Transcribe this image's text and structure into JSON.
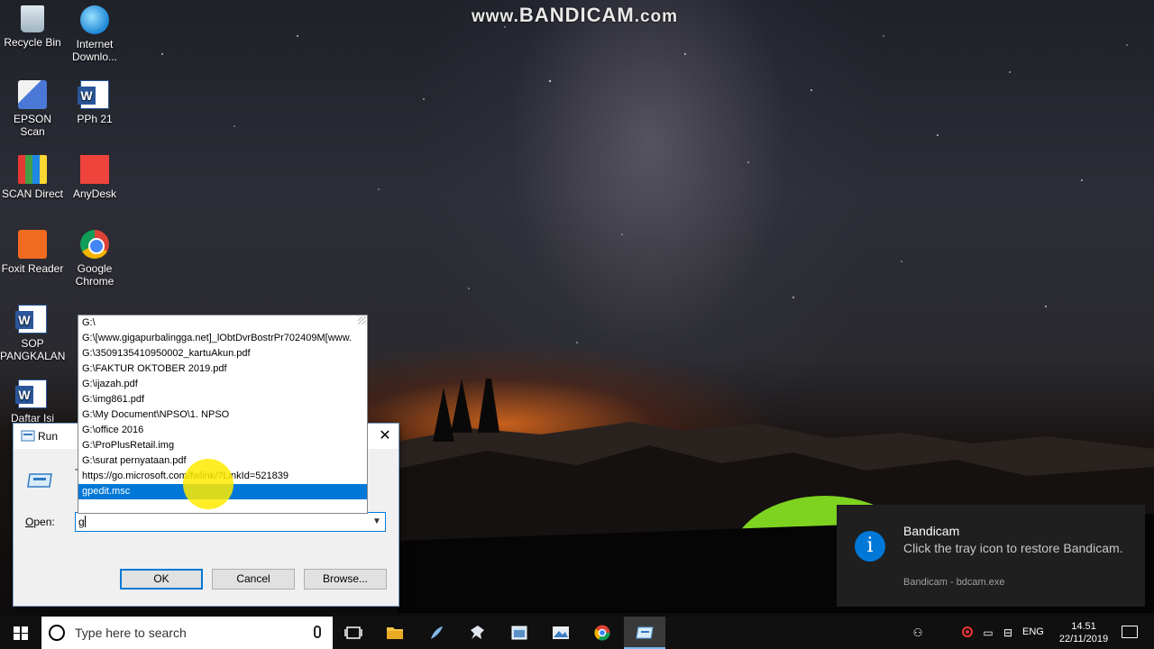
{
  "watermark": {
    "prefix": "www.",
    "brand": "BANDICAM",
    "suffix": ".com"
  },
  "desktop": {
    "icons": [
      {
        "label": "Recycle Bin"
      },
      {
        "label": "Internet Downlo..."
      },
      {
        "label": "EPSON Scan"
      },
      {
        "label": "PPh 21"
      },
      {
        "label": "SCAN Direct"
      },
      {
        "label": "AnyDesk"
      },
      {
        "label": "Foxit Reader"
      },
      {
        "label": "Google Chrome"
      },
      {
        "label": "SOP PANGKALAN"
      },
      {
        "label": "Daftar Isi"
      }
    ]
  },
  "run_dialog": {
    "title": "Run",
    "close_glyph": "✕",
    "description": "T",
    "open_label_accel": "O",
    "open_label_rest": "pen:",
    "input_value": "g",
    "ok_label": "OK",
    "cancel_label": "Cancel",
    "browse_label": "Browse...",
    "autocomplete": [
      "G:\\",
      "G:\\[www.gigapurbalingga.net]_lObtDvrBostrPr702409M[www.",
      "G:\\3509135410950002_kartuAkun.pdf",
      "G:\\FAKTUR OKTOBER 2019.pdf",
      "G:\\ijazah.pdf",
      "G:\\img861.pdf",
      "G:\\My Document\\NPSO\\1. NPSO",
      "G:\\office 2016",
      "G:\\ProPlusRetail.img",
      "G:\\surat pernyataan.pdf",
      "https://go.microsoft.com/fwlink/?LinkId=521839",
      "gpedit.msc"
    ],
    "selected_index": 11
  },
  "notification": {
    "title": "Bandicam",
    "body": "Click the tray icon to restore Bandicam.",
    "source": "Bandicam - bdcam.exe",
    "icon_glyph": "i"
  },
  "taskbar": {
    "search_placeholder": "Type here to search",
    "language": "ENG",
    "time": "14.51",
    "date": "22/11/2019",
    "apps": [
      "task-view",
      "file-explorer",
      "feather-app",
      "pin-app",
      "screenshot-app",
      "photo-app",
      "chrome",
      "run"
    ]
  },
  "colors": {
    "accent": "#0078d7",
    "taskbar": "#101010",
    "toast": "#1f1f1f"
  }
}
